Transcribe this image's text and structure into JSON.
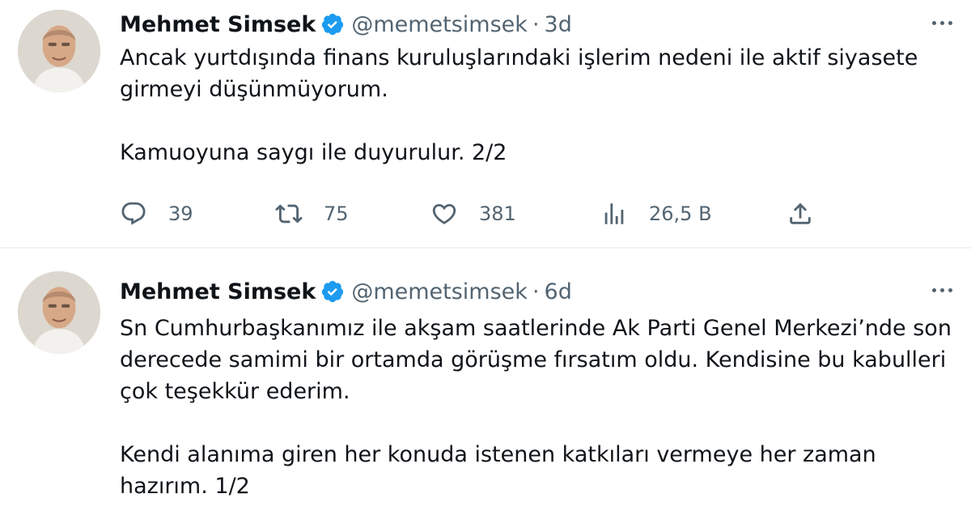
{
  "tweets": [
    {
      "author_name": "Mehmet Simsek",
      "handle": "@memetsimsek",
      "separator": "·",
      "time": "3d",
      "paragraphs": [
        "Ancak yurtdışında finans kuruluşlarındaki işlerim nedeni ile aktif siyasete girmeyi düşünmüyorum.",
        "Kamuoyuna saygı ile duyurulur. 2/2"
      ],
      "replies": "39",
      "retweets": "75",
      "likes": "381",
      "views": "26,5 B"
    },
    {
      "author_name": "Mehmet Simsek",
      "handle": "@memetsimsek",
      "separator": "·",
      "time": "6d",
      "paragraphs": [
        "Sn Cumhurbaşkanımız ile akşam saatlerinde Ak Parti Genel Merkezi’nde son derecede samimi bir ortamda görüşme fırsatım oldu. Kendisine bu kabulleri çok teşekkür ederim.",
        "Kendi alanıma giren her konuda istenen katkıları vermeye her zaman hazırım.  1/2"
      ]
    }
  ],
  "icons": {
    "verified": "verified-badge-icon",
    "more": "more-options-icon",
    "reply": "reply-icon",
    "retweet": "retweet-icon",
    "like": "like-icon",
    "views": "views-icon",
    "share": "share-icon"
  },
  "colors": {
    "text": "#0f1419",
    "secondary": "#536471",
    "verified": "#1d9bf0",
    "divider": "#eff3f4"
  }
}
